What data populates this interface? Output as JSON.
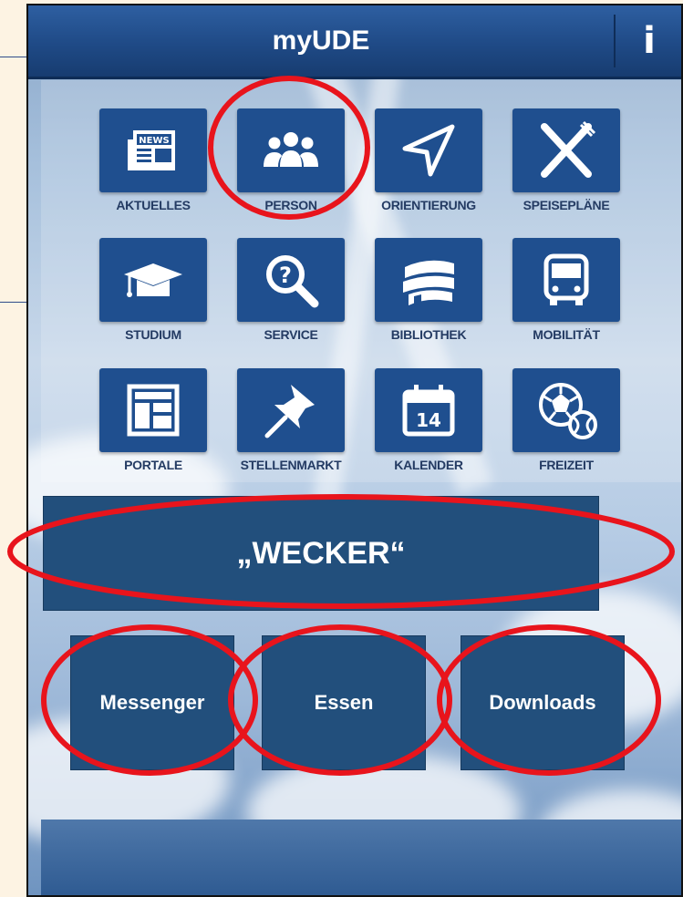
{
  "app": {
    "title": "myUDE",
    "info_label": "i"
  },
  "tiles": [
    {
      "label": "AKTUELLES",
      "icon": "news-icon"
    },
    {
      "label": "PERSON",
      "icon": "people-icon"
    },
    {
      "label": "ORIENTIERUNG",
      "icon": "navigation-arrow-icon"
    },
    {
      "label": "SPEISEPLÄNE",
      "icon": "knife-fork-icon"
    },
    {
      "label": "STUDIUM",
      "icon": "graduation-cap-icon"
    },
    {
      "label": "SERVICE",
      "icon": "help-search-icon"
    },
    {
      "label": "BIBLIOTHEK",
      "icon": "books-icon"
    },
    {
      "label": "MOBILITÄT",
      "icon": "bus-icon"
    },
    {
      "label": "PORTALE",
      "icon": "portal-layout-icon"
    },
    {
      "label": "STELLENMARKT",
      "icon": "pushpin-icon"
    },
    {
      "label": "KALENDER",
      "icon": "calendar-icon",
      "calendar_day": "14"
    },
    {
      "label": "FREIZEIT",
      "icon": "sports-balls-icon"
    }
  ],
  "buttons": {
    "wecker": "„WECKER“",
    "messenger": "Messenger",
    "essen": "Essen",
    "downloads": "Downloads"
  },
  "colors": {
    "tile_blue": "#1f4f8f",
    "button_blue": "#224f7c",
    "header_blue": "#1f4a86",
    "annotation_red": "#e8141c"
  }
}
